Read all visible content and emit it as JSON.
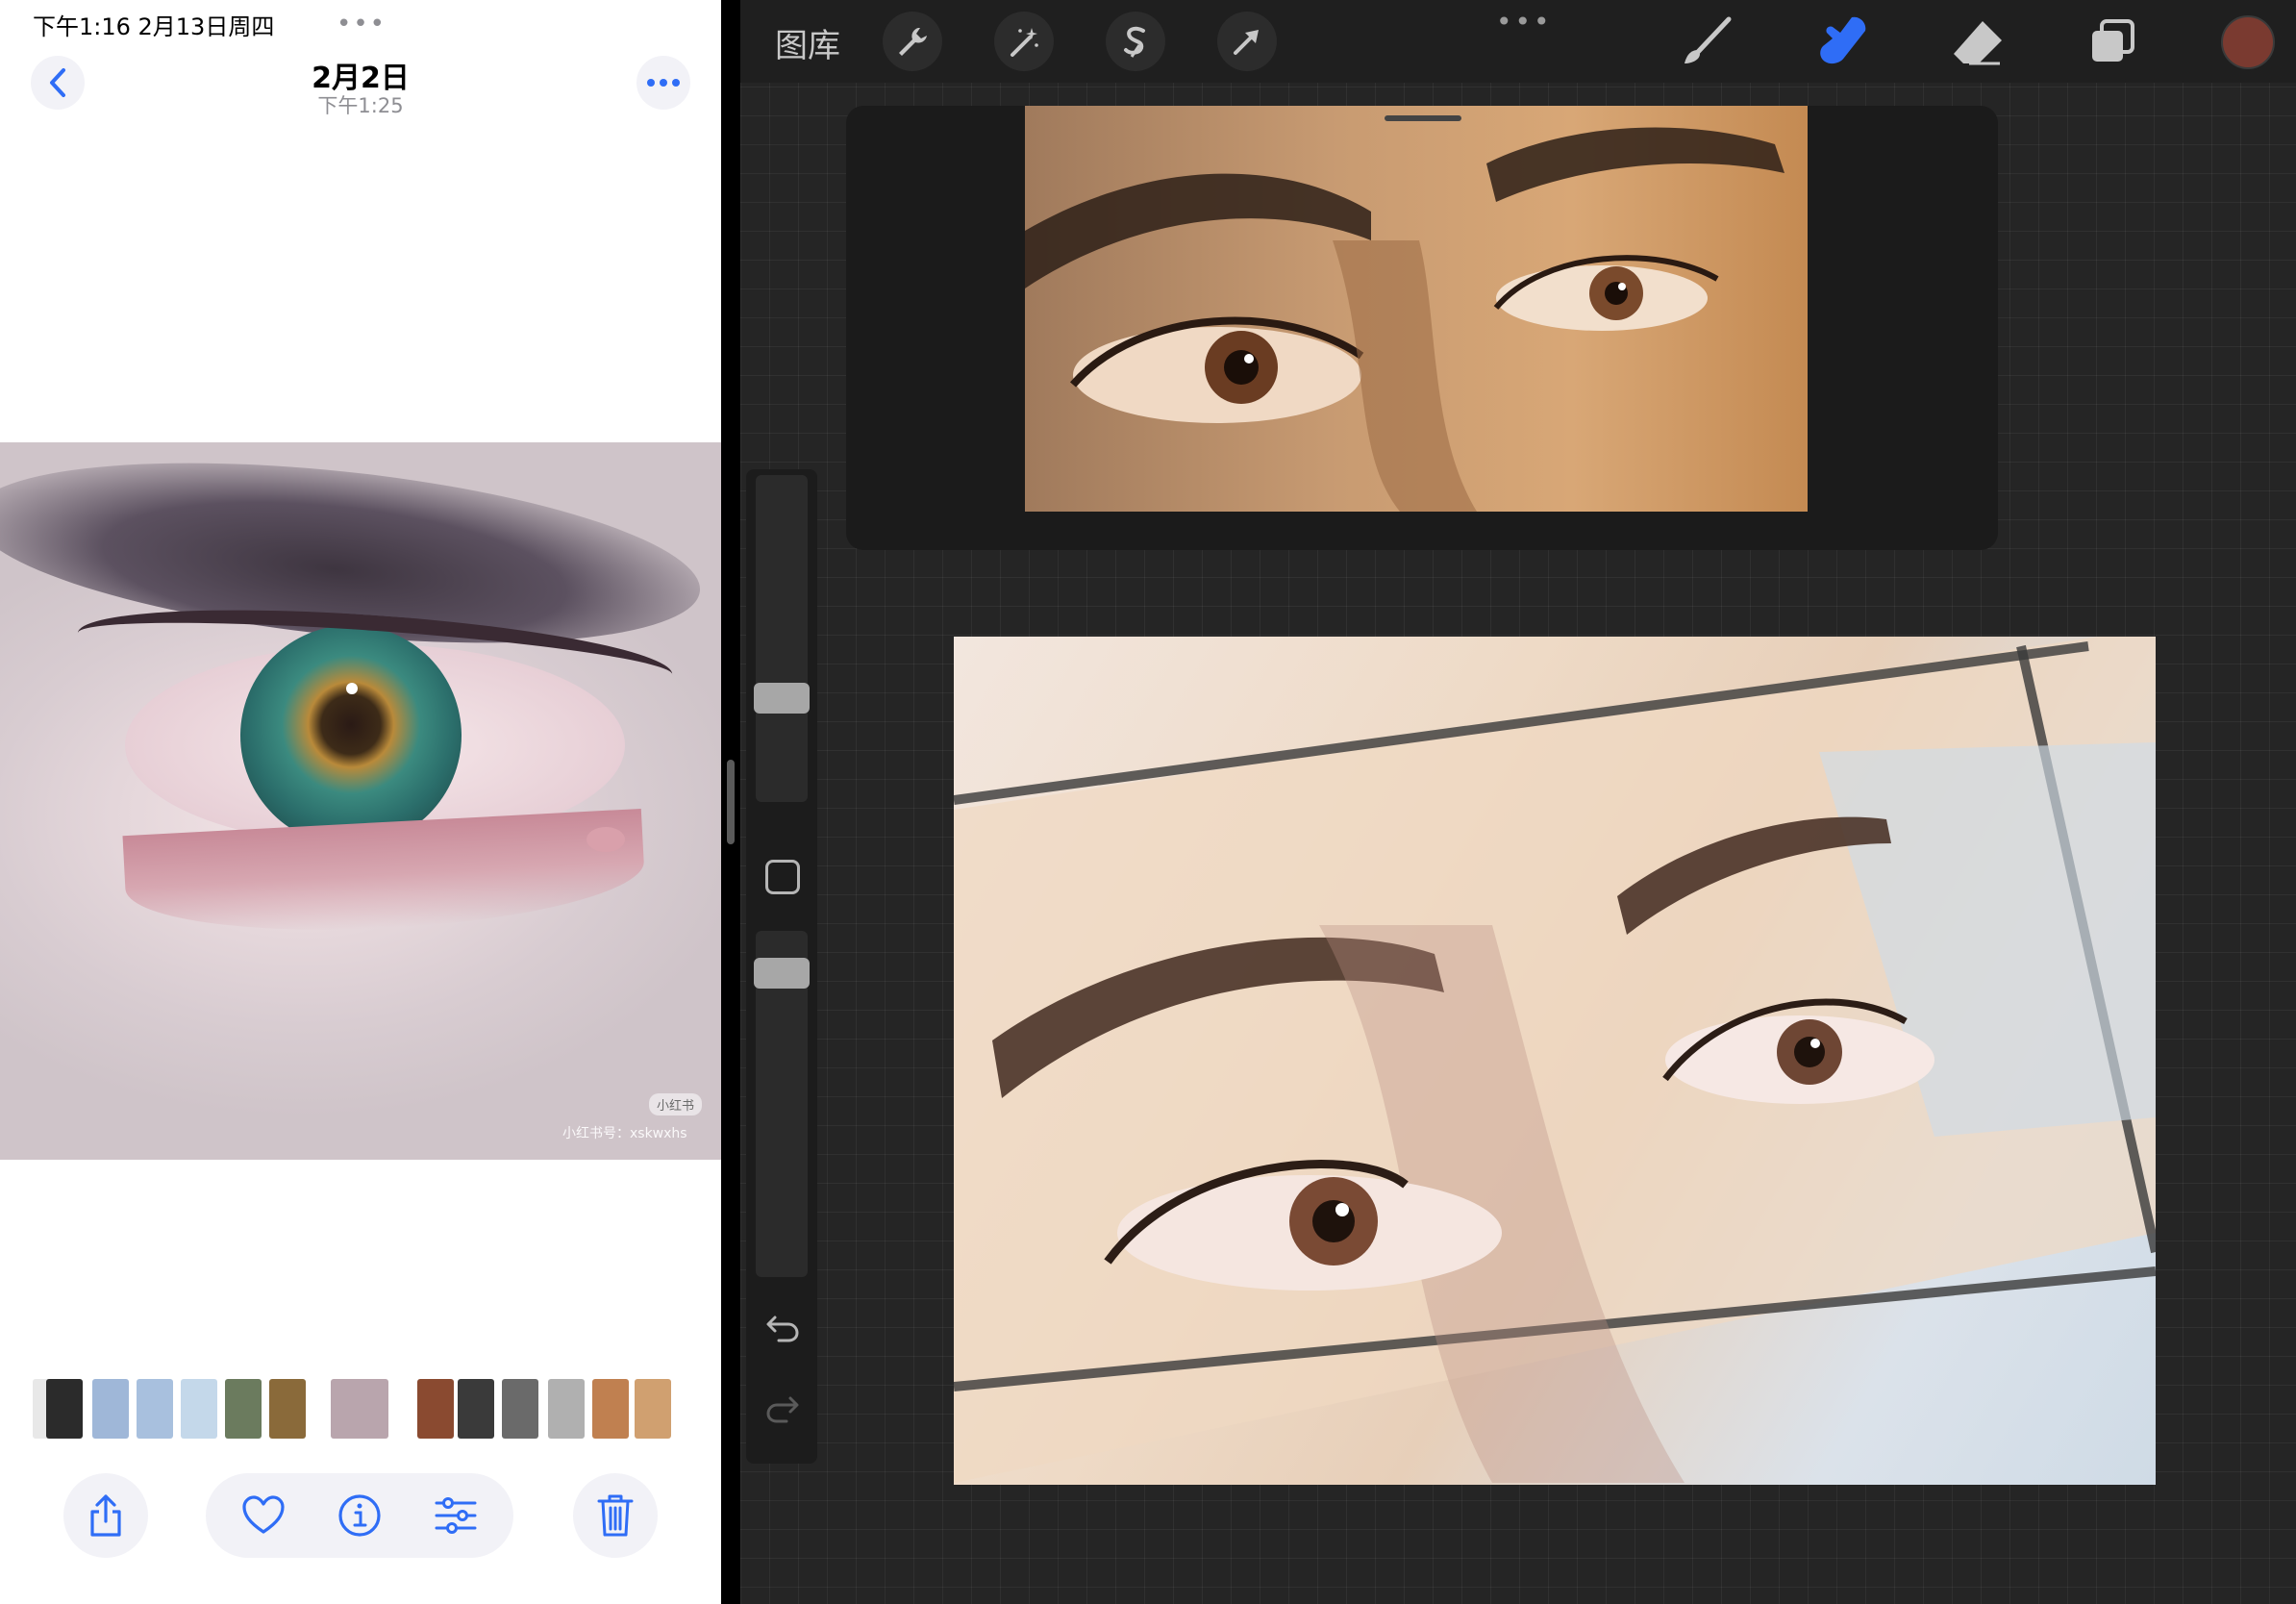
{
  "status_bar": {
    "time_date": "下午1:16   2月13日周四",
    "dots": "•••"
  },
  "photos": {
    "title": "2月2日",
    "subtitle": "下午1:25",
    "watermark_badge": "小红书",
    "watermark_text": "小红书号：xskwxhs",
    "thumbnails": [
      {
        "color": "#e8e8e8"
      },
      {
        "color": "#2b2b2b"
      },
      {
        "color": "#9fb7d8"
      },
      {
        "color": "#a8c0de"
      },
      {
        "color": "#c4d8ea"
      },
      {
        "color": "#6b7b5e"
      },
      {
        "color": "#8a6a3a"
      },
      {
        "color": "#b9a5ad"
      },
      {
        "color": "#8a4a30"
      },
      {
        "color": "#3a3a3a"
      },
      {
        "color": "#6a6a6a"
      },
      {
        "color": "#b0b0b0"
      },
      {
        "color": "#c08050"
      },
      {
        "color": "#d0a070"
      }
    ]
  },
  "procreate": {
    "gallery_label": "图库",
    "top_dots": "•••",
    "accent_color": "#2f6df6",
    "current_color": "#7a3a30"
  }
}
